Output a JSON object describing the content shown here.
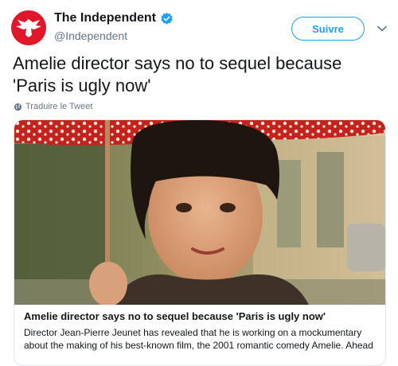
{
  "account": {
    "display_name": "The Independent",
    "handle": "@Independent"
  },
  "follow_label": "Suivre",
  "tweet": {
    "text_line1": "Amelie director says no to sequel because",
    "text_line2": "'Paris is ugly now'",
    "translate_label": "Traduire le Tweet"
  },
  "card": {
    "title": "Amelie director says no to sequel because 'Paris is ugly now'",
    "description_line1": "Director Jean-Pierre Jeunet has revealed that he is working on a mockumentary",
    "description_line2": "about the making of his best-known film, the 2001 romantic comedy Amelie.  Ahead"
  },
  "colors": {
    "brand_red": "#e0162b",
    "twitter_blue": "#1da1f2",
    "secondary_text": "#657786"
  },
  "icons": {
    "avatar": "eagle-logo-icon",
    "verified": "verified-badge-icon",
    "menu": "chevron-down-icon",
    "translate": "globe-icon"
  }
}
